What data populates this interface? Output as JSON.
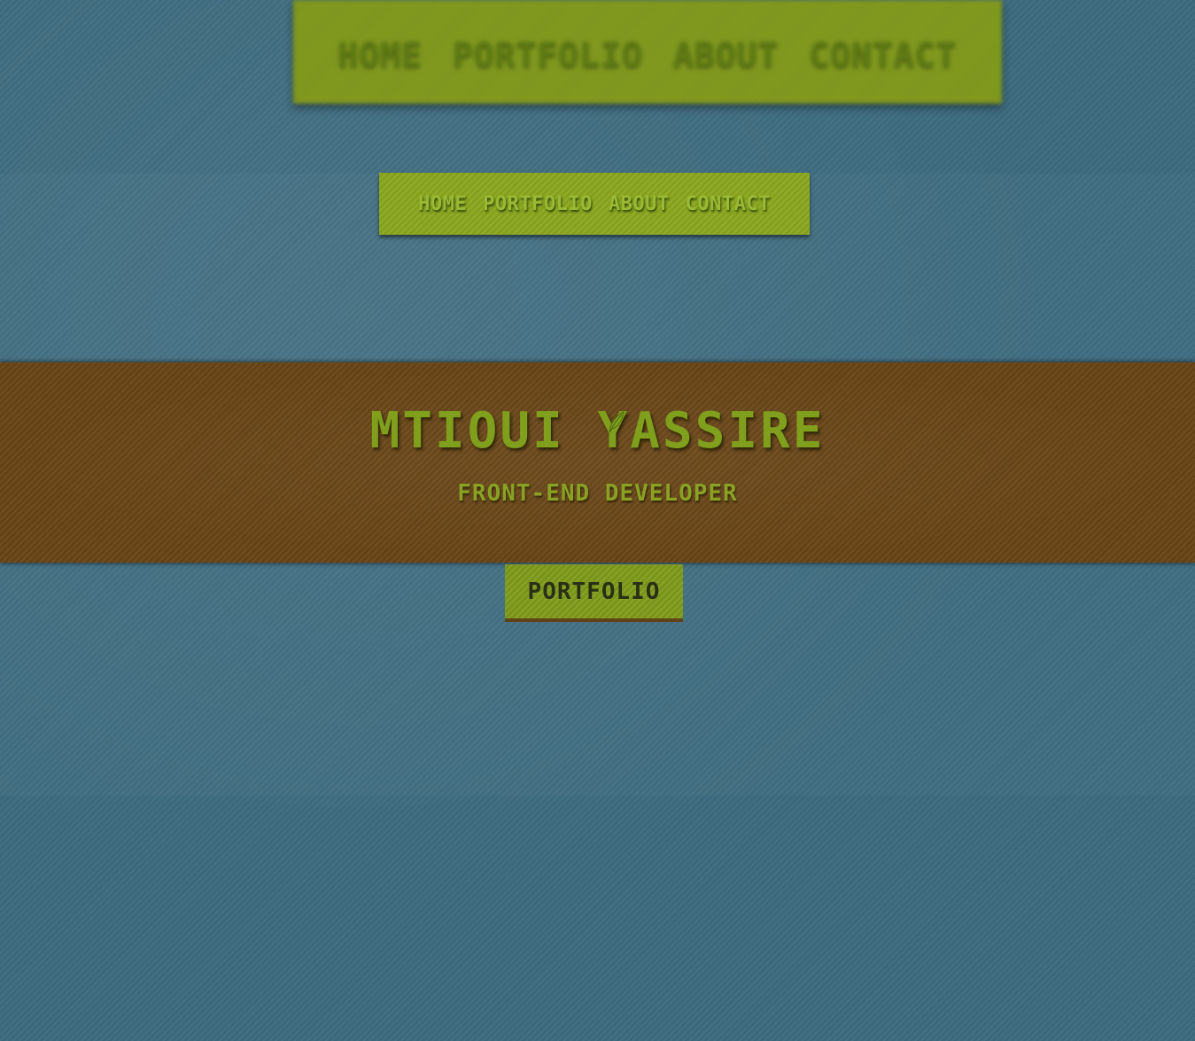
{
  "top_nav": {
    "items": [
      {
        "label": "HOME"
      },
      {
        "label": "PORTFOLIO"
      },
      {
        "label": "ABOUT"
      },
      {
        "label": "CONTACT"
      }
    ]
  },
  "main_nav": {
    "items": [
      {
        "label": "HOME"
      },
      {
        "label": "PORTFOLIO"
      },
      {
        "label": "ABOUT"
      },
      {
        "label": "CONTACT"
      }
    ]
  },
  "hero": {
    "name": "MTIOUI YASSIRE",
    "title": "FRONT-END DEVELOPER",
    "icon": "leaf-icon"
  },
  "cta": {
    "label": "PORTFOLIO"
  },
  "colors": {
    "background": "#3d6b7f",
    "nav_green": "#8aa61e",
    "hero_brown": "#6a4617",
    "text_green": "#7f9f1d"
  }
}
